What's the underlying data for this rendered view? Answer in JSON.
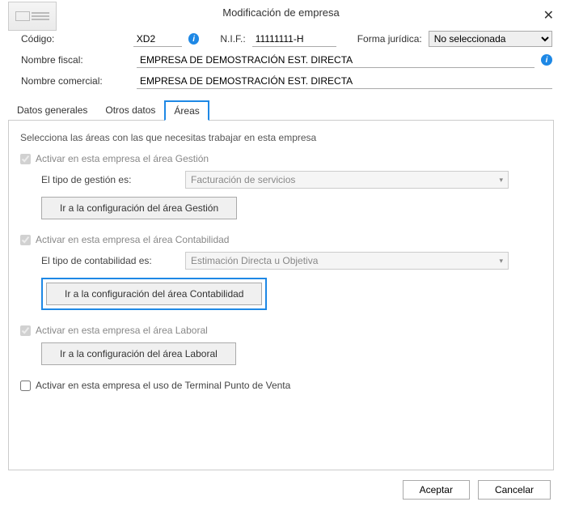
{
  "window": {
    "title": "Modificación de empresa",
    "close": "✕"
  },
  "fields": {
    "codigo_label": "Código:",
    "codigo_value": "XD2",
    "nif_label": "N.I.F.:",
    "nif_value": "11111111-H",
    "forma_label": "Forma jurídica:",
    "forma_value": "No seleccionada",
    "nombre_fiscal_label": "Nombre fiscal:",
    "nombre_fiscal_value": "EMPRESA DE DEMOSTRACIÓN EST. DIRECTA",
    "nombre_comercial_label": "Nombre comercial:",
    "nombre_comercial_value": "EMPRESA DE DEMOSTRACIÓN EST. DIRECTA"
  },
  "tabs": [
    {
      "label": "Datos generales",
      "active": false
    },
    {
      "label": "Otros datos",
      "active": false
    },
    {
      "label": "Áreas",
      "active": true
    }
  ],
  "panel": {
    "instruction": "Selecciona las áreas con las que necesitas trabajar en esta empresa",
    "gestion": {
      "chk_label": "Activar en esta empresa el área Gestión",
      "checked": true,
      "type_label": "El tipo de gestión es:",
      "type_value": "Facturación de servicios",
      "btn": "Ir a la configuración del área Gestión"
    },
    "contabilidad": {
      "chk_label": "Activar en esta empresa el área Contabilidad",
      "checked": true,
      "type_label": "El tipo de contabilidad es:",
      "type_value": "Estimación Directa u Objetiva",
      "btn": "Ir a la configuración del área Contabilidad"
    },
    "laboral": {
      "chk_label": "Activar en esta empresa el área Laboral",
      "checked": true,
      "btn": "Ir a la configuración del área Laboral"
    },
    "tpv": {
      "chk_label": "Activar en esta empresa el uso de Terminal Punto de Venta",
      "checked": false
    }
  },
  "footer": {
    "accept": "Aceptar",
    "cancel": "Cancelar"
  },
  "icons": {
    "info": "i",
    "caret": "▾"
  }
}
